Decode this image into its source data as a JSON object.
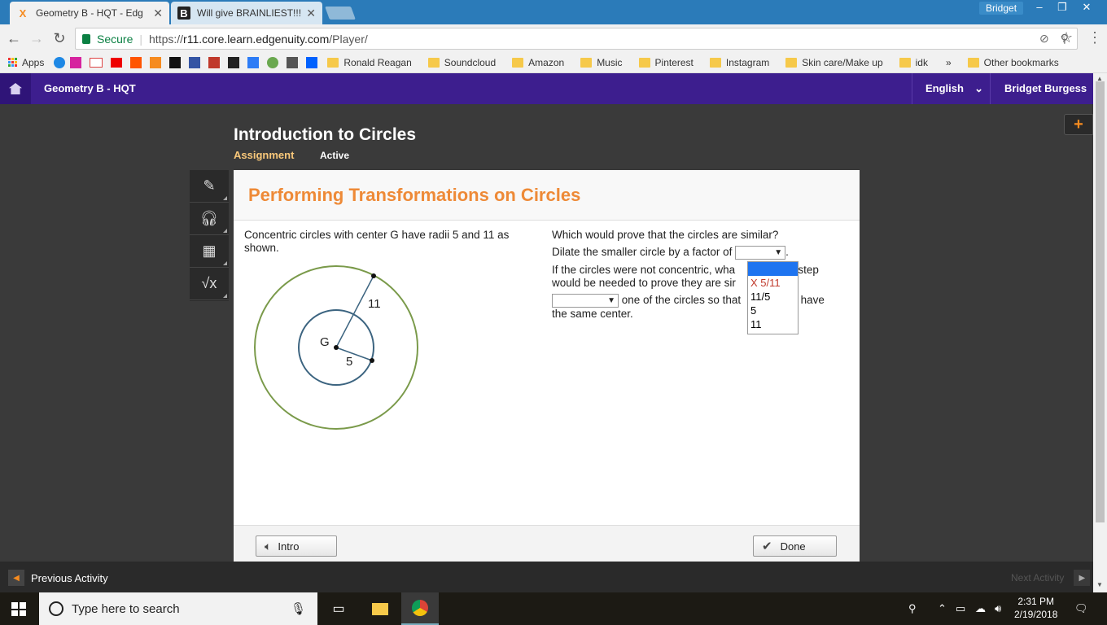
{
  "browser": {
    "tabs": [
      {
        "title": "Geometry B - HQT - Edg",
        "favicon": "X"
      },
      {
        "title": "Will give BRAINLIEST!!! -",
        "favicon": "B"
      }
    ],
    "user": "Bridget",
    "secure_label": "Secure",
    "url_prefix": "https://",
    "url_host": "r11.core.learn.edgenuity.com",
    "url_path": "/Player/",
    "bookmarks": {
      "apps": "Apps",
      "folders": [
        "Ronald Reagan",
        "Soundcloud",
        "Amazon",
        "Music",
        "Pinterest",
        "Instagram",
        "Skin care/Make up",
        "idk"
      ],
      "overflow": "»",
      "other": "Other bookmarks"
    }
  },
  "header": {
    "course": "Geometry B - HQT",
    "language": "English",
    "user_name": "Bridget Burgess"
  },
  "lesson": {
    "title": "Introduction to Circles",
    "type": "Assignment",
    "status": "Active"
  },
  "panel": {
    "heading": "Performing Transformations on Circles",
    "left_text": "Concentric circles with center G have radii 5 and 11 as shown.",
    "figure": {
      "center_label": "G",
      "small_radius": "5",
      "large_radius": "11"
    },
    "question": "Which would prove that the circles are similar?",
    "line1": "Dilate the smaller circle by a factor of",
    "q2_part1": "If the circles were not concentric, wha",
    "q2_part2": "al step",
    "q2_line2": "would be needed to prove they are sir",
    "line3_a": "one of the circles so that",
    "line3_b": "s have",
    "line3_c": "the same center.",
    "period": ".",
    "dropdown_options": [
      "",
      "X 5/11",
      "11/5",
      "5",
      "11"
    ],
    "intro_button": "Intro",
    "done_button": "Done"
  },
  "footer": {
    "previous": "Previous Activity",
    "next": "Next Activity"
  },
  "taskbar": {
    "search_placeholder": "Type here to search",
    "time": "2:31 PM",
    "date": "2/19/2018"
  }
}
